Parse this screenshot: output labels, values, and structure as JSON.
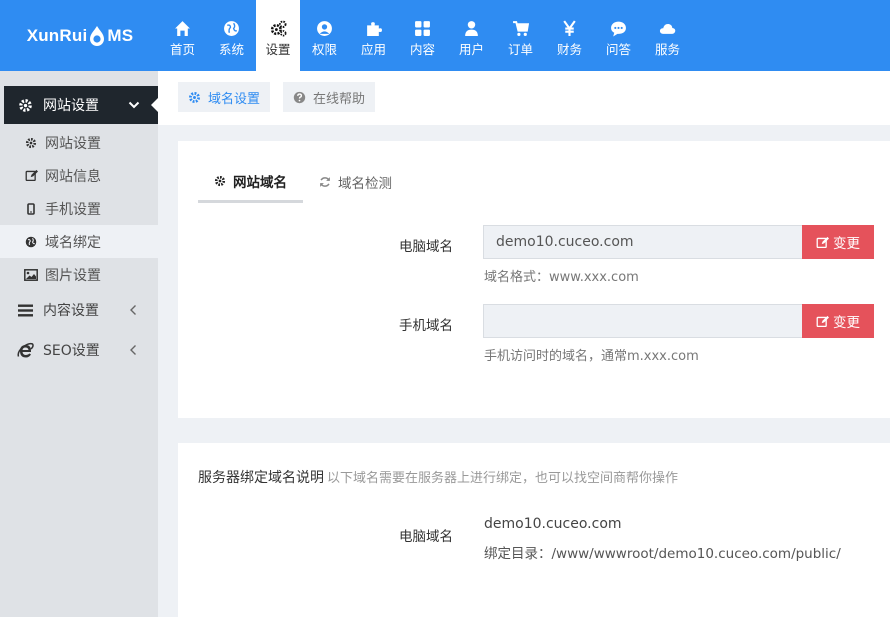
{
  "logo": {
    "part1": "XunRui",
    "part2": "MS"
  },
  "nav": [
    {
      "label": "首页",
      "icon": "home-icon"
    },
    {
      "label": "系统",
      "icon": "globe-icon"
    },
    {
      "label": "设置",
      "icon": "cogs-icon"
    },
    {
      "label": "权限",
      "icon": "user-circle-icon"
    },
    {
      "label": "应用",
      "icon": "puzzle-icon"
    },
    {
      "label": "内容",
      "icon": "grid-icon"
    },
    {
      "label": "用户",
      "icon": "user-icon"
    },
    {
      "label": "订单",
      "icon": "cart-icon"
    },
    {
      "label": "财务",
      "icon": "yen-icon"
    },
    {
      "label": "问答",
      "icon": "chat-icon"
    },
    {
      "label": "服务",
      "icon": "cloud-icon"
    }
  ],
  "nav_active": "设置",
  "sidebar": {
    "head": "网站设置",
    "items": [
      {
        "label": "网站设置",
        "icon": "cog-icon"
      },
      {
        "label": "网站信息",
        "icon": "edit-icon"
      },
      {
        "label": "手机设置",
        "icon": "mobile-icon"
      },
      {
        "label": "域名绑定",
        "icon": "globe-icon"
      },
      {
        "label": "图片设置",
        "icon": "image-icon"
      }
    ],
    "groups": [
      {
        "label": "内容设置",
        "icon": "menu-icon"
      },
      {
        "label": "SEO设置",
        "icon": "ie-icon"
      }
    ]
  },
  "toolbar": {
    "domain_settings": "域名设置",
    "online_help": "在线帮助"
  },
  "tabs": {
    "site_domain": "网站域名",
    "domain_check": "域名检测"
  },
  "form": {
    "pc_label": "电脑域名",
    "pc_value": "demo10.cuceo.com",
    "pc_help": "域名格式：www.xxx.com",
    "mobile_label": "手机域名",
    "mobile_value": "",
    "mobile_help": "手机访问时的域名，通常m.xxx.com",
    "change_label": "变更"
  },
  "server": {
    "title": "服务器绑定域名说明",
    "note": "以下域名需要在服务器上进行绑定，也可以找空间商帮你操作",
    "pc_label": "电脑域名",
    "pc_domain": "demo10.cuceo.com",
    "bind_dir": "绑定目录：/www/wwwroot/demo10.cuceo.com/public/"
  },
  "colors": {
    "brand": "#2f8cf2",
    "danger": "#e5525b",
    "sidebar_dark": "#1f262d"
  }
}
